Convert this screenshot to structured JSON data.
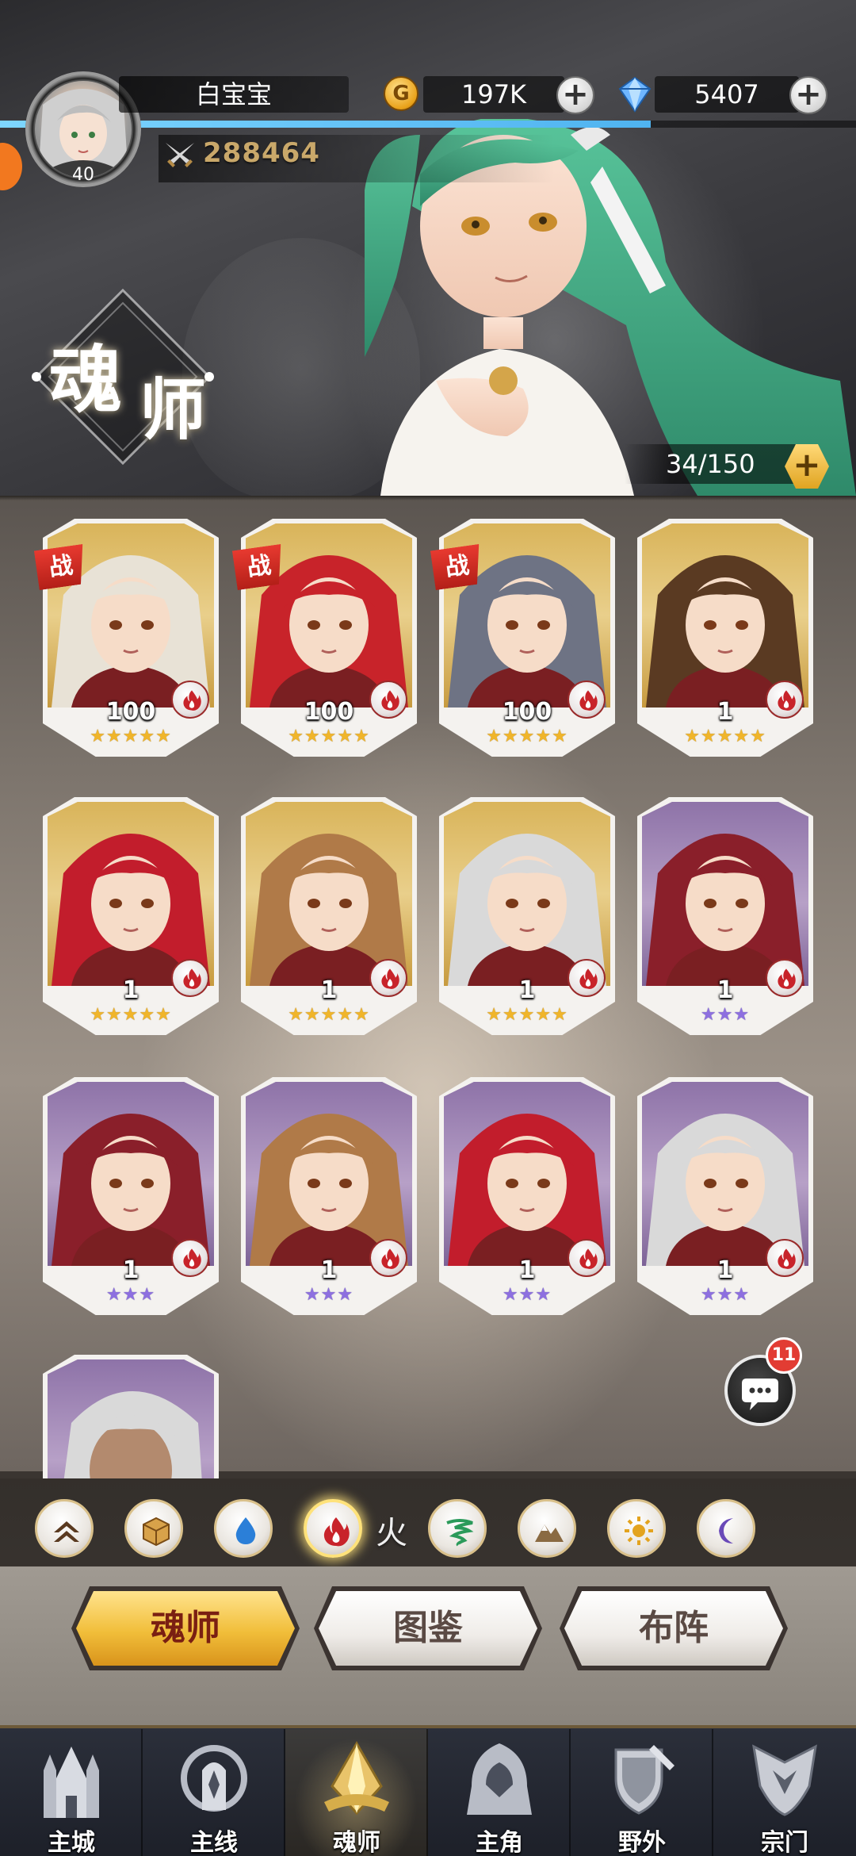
{
  "player": {
    "name": "白宝宝",
    "level": "40",
    "power": "288464"
  },
  "currency": {
    "gold": "197K",
    "diamonds": "5407"
  },
  "page": {
    "title_char_1": "魂",
    "title_char_2": "师",
    "capacity": "34/150"
  },
  "heroes": [
    {
      "level": "100",
      "stars": "★★★★★",
      "rarity": "gold",
      "in_battle": true,
      "battle_tag": "战",
      "element": "fire-icon",
      "hair": "#e8e2d6"
    },
    {
      "level": "100",
      "stars": "★★★★★",
      "rarity": "gold",
      "in_battle": true,
      "battle_tag": "战",
      "element": "fire-icon",
      "hair": "#c8232a"
    },
    {
      "level": "100",
      "stars": "★★★★★",
      "rarity": "gold",
      "in_battle": true,
      "battle_tag": "战",
      "element": "fire-icon",
      "hair": "#6e7384"
    },
    {
      "level": "1",
      "stars": "★★★★★",
      "rarity": "gold",
      "in_battle": false,
      "element": "fire-icon",
      "hair": "#5a3a22"
    },
    {
      "level": "1",
      "stars": "★★★★★",
      "rarity": "gold",
      "in_battle": false,
      "element": "fire-icon",
      "hair": "#c21d2c"
    },
    {
      "level": "1",
      "stars": "★★★★★",
      "rarity": "gold",
      "in_battle": false,
      "element": "fire-icon",
      "hair": "#b07a48"
    },
    {
      "level": "1",
      "stars": "★★★★★",
      "rarity": "gold",
      "in_battle": false,
      "element": "fire-icon",
      "hair": "#d9d9d9"
    },
    {
      "level": "1",
      "stars": "★★★",
      "rarity": "purple",
      "in_battle": false,
      "element": "fire-icon",
      "hair": "#8a1f2a"
    },
    {
      "level": "1",
      "stars": "★★★",
      "rarity": "purple",
      "in_battle": false,
      "element": "fire-icon",
      "hair": "#8a1f2a"
    },
    {
      "level": "1",
      "stars": "★★★",
      "rarity": "purple",
      "in_battle": false,
      "element": "fire-icon",
      "hair": "#b07a48"
    },
    {
      "level": "1",
      "stars": "★★★",
      "rarity": "purple",
      "in_battle": false,
      "element": "fire-icon",
      "hair": "#c21d2c"
    },
    {
      "level": "1",
      "stars": "★★★",
      "rarity": "purple",
      "in_battle": false,
      "element": "fire-icon",
      "hair": "#d9d9d9"
    }
  ],
  "filters": {
    "active_label": "火",
    "items": [
      "rank-up-icon",
      "box-icon",
      "water-icon",
      "fire-icon",
      "wind-icon",
      "earth-icon",
      "light-icon",
      "dark-icon"
    ]
  },
  "chat": {
    "badge": "11"
  },
  "tabs": {
    "soul_master": "魂师",
    "codex": "图鉴",
    "formation": "布阵"
  },
  "nav": {
    "main_city": "主城",
    "main_line": "主线",
    "soul_master": "魂师",
    "protagonist": "主角",
    "wild": "野外",
    "sect": "宗门"
  },
  "colors": {
    "accent_gold": "#f1be3a",
    "fire_red": "#c8232a",
    "battle_tag": "#e83a30",
    "gold_star": "#f0b52a",
    "purple_star": "#8d6fe0"
  }
}
